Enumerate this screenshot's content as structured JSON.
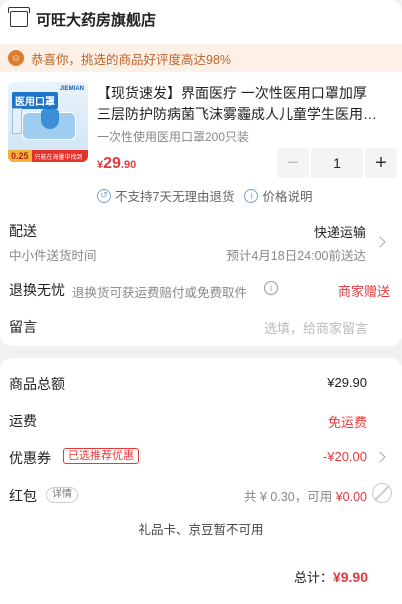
{
  "store": {
    "name": "可旺大药房旗舰店"
  },
  "banner": {
    "icon": "smile-icon",
    "text": "恭喜你，挑选的商品好评度高达98%"
  },
  "product": {
    "image_title": "医用口罩",
    "image_brand": "JIEMIAN",
    "image_price": "0.25",
    "image_promo": "只能在海量中找到",
    "title_line1": "【现货速发】界面医疗 一次性医用口罩加厚",
    "title_line2": "三层防护防病菌飞沫雾霾成人儿童学生医用…",
    "spec": "一次性使用医用口罩200只装",
    "price_currency": "¥",
    "price_int": "29",
    "price_dec": ".90",
    "quantity": "1",
    "minus": "−",
    "plus": "+",
    "service_return": "不支持7天无理由退货",
    "service_price": "价格说明"
  },
  "delivery": {
    "label": "配送",
    "sub": "中小件送货时间",
    "method": "快递运输",
    "eta": "预计4月18日24:00前送达"
  },
  "returns": {
    "label": "退换无忧",
    "desc": "退换货可获运费赔付或免费取件",
    "gift": "商家赠送"
  },
  "note": {
    "label": "留言",
    "placeholder": "选填，给商家留言"
  },
  "summary": {
    "goods_label": "商品总额",
    "goods_value": "¥29.90",
    "freight_label": "运费",
    "freight_value": "免运费",
    "coupon_label": "优惠券",
    "coupon_tag": "已选推荐优惠",
    "coupon_value": "-¥20.00",
    "redpack_label": "红包",
    "redpack_tag": "详情",
    "redpack_total": "共 ¥ 0.30，可用",
    "redpack_avail": "¥0.00",
    "gift_note": "礼品卡、京豆暂不可用",
    "total_label": "总计：",
    "total_value": "¥9.90"
  },
  "colors": {
    "accent": "#e4393c",
    "banner_bg": "#fdf0e6",
    "banner_text": "#c0632a"
  }
}
